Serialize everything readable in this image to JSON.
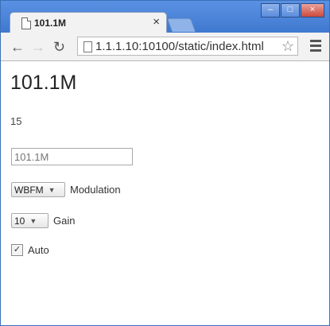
{
  "browser": {
    "tab_title": "101.1M",
    "url": "1.1.1.10:10100/static/index.html"
  },
  "page": {
    "heading": "101.1M",
    "small_text": "15",
    "frequency_input": {
      "value": "",
      "placeholder": "101.1M"
    },
    "modulation": {
      "selected": "WBFM",
      "label": "Modulation"
    },
    "gain": {
      "selected": "10",
      "label": "Gain"
    },
    "auto": {
      "checked": true,
      "label": "Auto"
    }
  },
  "icons": {
    "tab_icon": "document-icon",
    "back": "back-arrow-icon",
    "forward": "forward-arrow-icon",
    "reload": "reload-icon",
    "star": "star-icon",
    "menu": "menu-icon"
  }
}
